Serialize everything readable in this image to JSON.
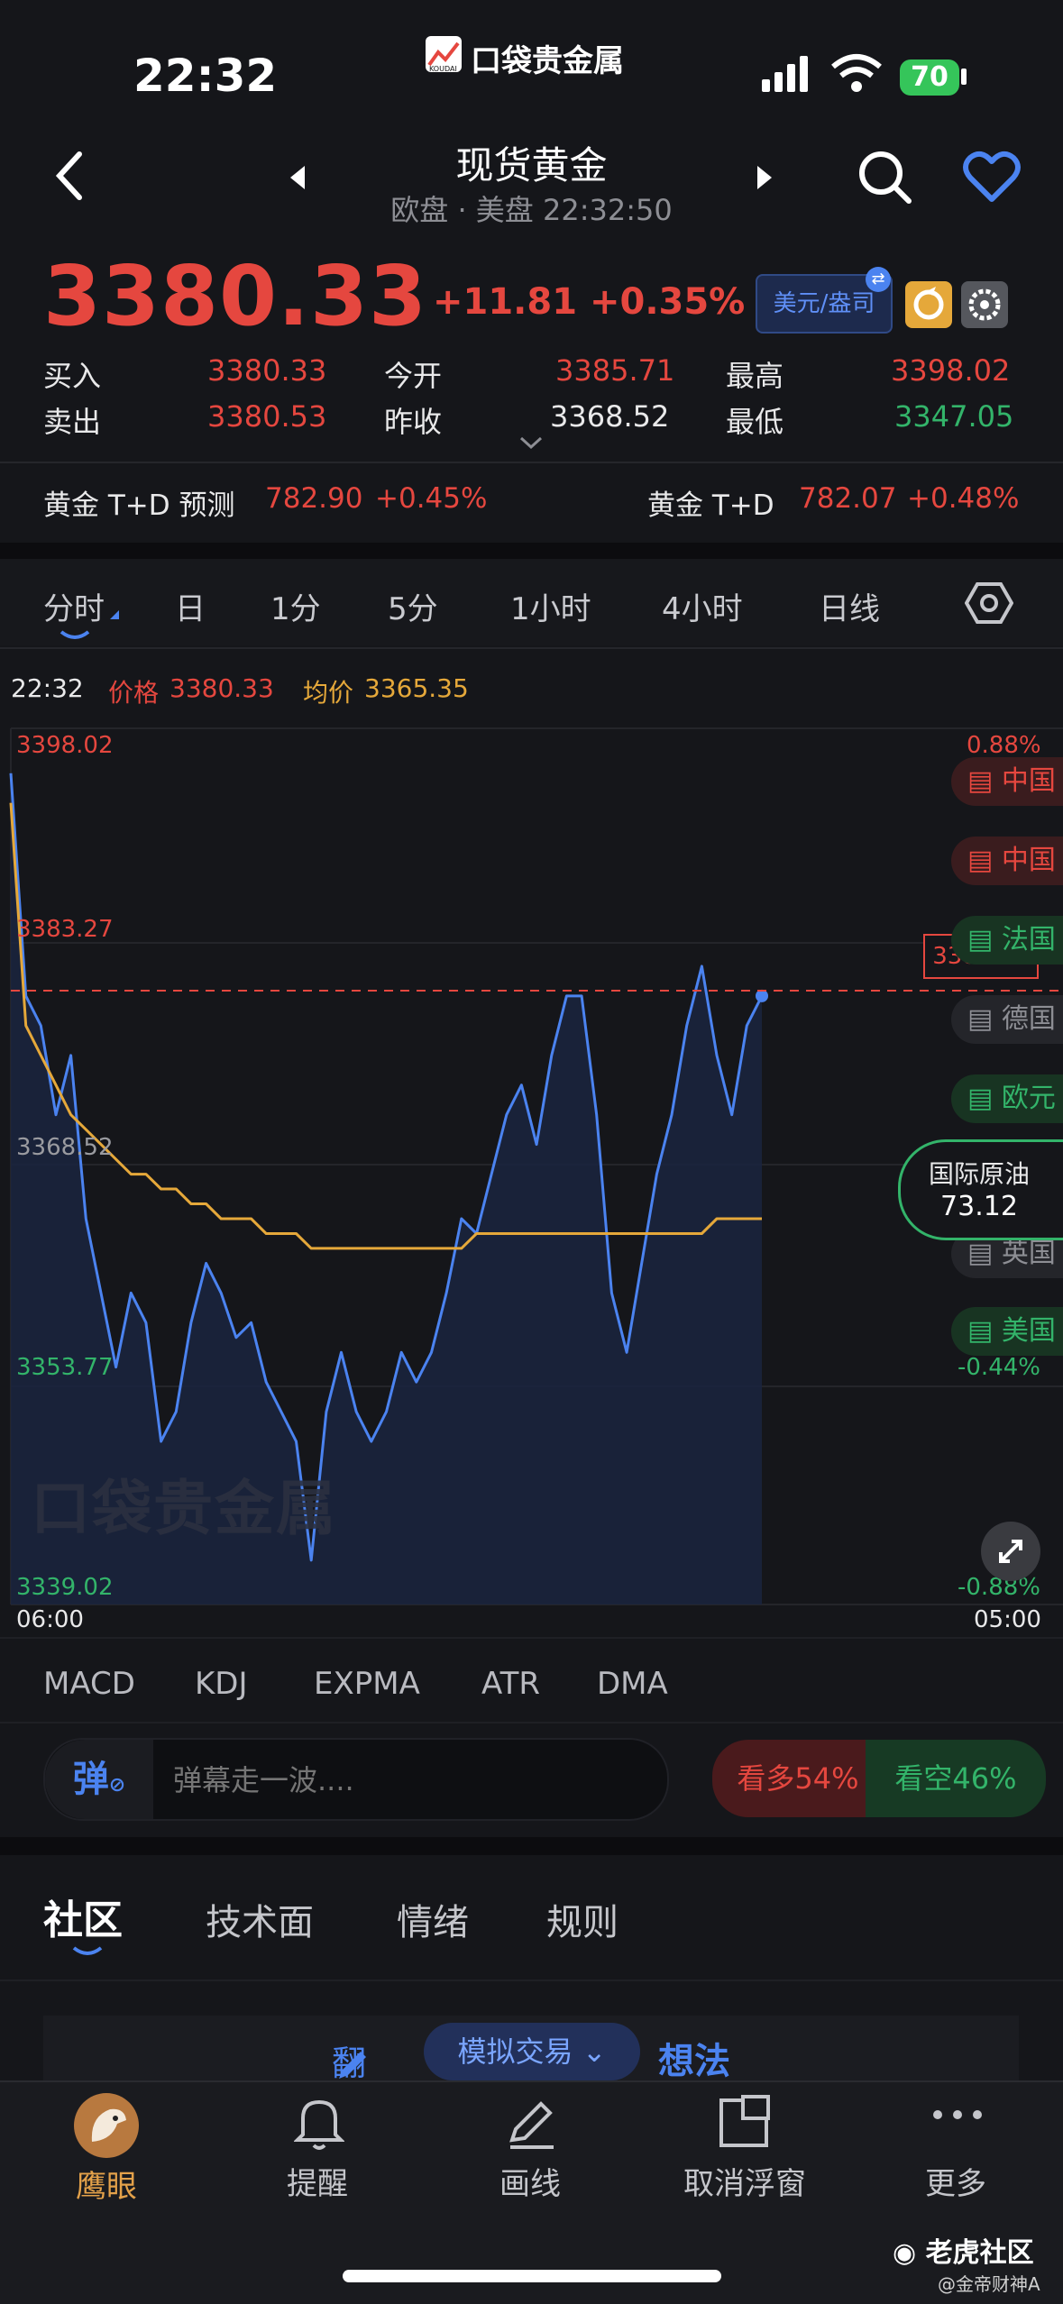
{
  "status_bar": {
    "time": "22:32",
    "app_logo": "口袋贵金属",
    "app_logo_sub": "KOUDAI",
    "battery": "70"
  },
  "header": {
    "title": "现货黄金",
    "subtitle": "欧盘 · 美盘 22:32:50"
  },
  "quote": {
    "price": "3380.33",
    "change": "+11.81 +0.35%",
    "currency_btn": "美元/盎司",
    "bid_label": "买入",
    "bid": "3380.33",
    "ask_label": "卖出",
    "ask": "3380.53",
    "open_label": "今开",
    "open": "3385.71",
    "prev_label": "昨收",
    "prev": "3368.52",
    "high_label": "最高",
    "high": "3398.02",
    "low_label": "最低",
    "low": "3347.05"
  },
  "td": {
    "forecast_label": "黄金 T+D 预测",
    "forecast_value": "782.90",
    "forecast_pct": "+0.45%",
    "td_label": "黄金 T+D",
    "td_value": "782.07",
    "td_pct": "+0.48%"
  },
  "period_tabs": [
    "分时",
    "日",
    "1分",
    "5分",
    "1小时",
    "4小时",
    "日线"
  ],
  "chart_head": {
    "time": "22:32",
    "price_label": "价格",
    "price": "3380.33",
    "avg_label": "均价",
    "avg": "3365.35"
  },
  "chart_data": {
    "type": "line",
    "series": [
      {
        "name": "价格",
        "values": [
          3395,
          3380,
          3378,
          3372,
          3376,
          3365,
          3360,
          3355,
          3360,
          3358,
          3350,
          3352,
          3358,
          3362,
          3360,
          3357,
          3358,
          3354,
          3352,
          3350,
          3342,
          3352,
          3356,
          3352,
          3350,
          3352,
          3356,
          3354,
          3356,
          3360,
          3365,
          3364,
          3368,
          3372,
          3374,
          3370,
          3376,
          3380,
          3380,
          3372,
          3360,
          3356,
          3362,
          3368,
          3372,
          3378,
          3382,
          3376,
          3372,
          3378,
          3380
        ]
      },
      {
        "name": "均价",
        "values": [
          3393,
          3378,
          3376,
          3374,
          3372,
          3371,
          3370,
          3369,
          3368,
          3368,
          3367,
          3367,
          3366,
          3366,
          3365,
          3365,
          3365,
          3364,
          3364,
          3364,
          3363,
          3363,
          3363,
          3363,
          3363,
          3363,
          3363,
          3363,
          3363,
          3363,
          3363,
          3364,
          3364,
          3364,
          3364,
          3364,
          3364,
          3364,
          3364,
          3364,
          3364,
          3364,
          3364,
          3364,
          3364,
          3364,
          3364,
          3365,
          3365,
          3365,
          3365
        ]
      }
    ],
    "y_ticks": [
      "3398.02",
      "3383.27",
      "3368.52",
      "3353.77",
      "3339.02"
    ],
    "pct_ticks": [
      "0.88%",
      "-0.44%",
      "-0.88%"
    ],
    "x_ticks": [
      "06:00",
      "05:00"
    ],
    "ylim": [
      3339.02,
      3398.02
    ],
    "current_price_label": "3380.33",
    "watermark": "口袋贵金属"
  },
  "event_tags": {
    "labels": [
      "中国",
      "中国",
      "法国",
      "德国",
      "欧元",
      "英国",
      "美国"
    ],
    "colors": [
      "#e5473f",
      "#e5473f",
      "#33b46a",
      "#8d8e94",
      "#33b46a",
      "#8d8e94",
      "#33b46a"
    ]
  },
  "oil_bubble": {
    "name": "国际原油",
    "value": "73.12"
  },
  "indicator_tabs": [
    "MACD",
    "KDJ",
    "EXPMA",
    "ATR",
    "DMA"
  ],
  "danmu": {
    "icon_text": "弹",
    "placeholder": "弹幕走一波...."
  },
  "sentiment": {
    "bull": "看多54%",
    "bear": "看空46%"
  },
  "content_tabs": [
    "社区",
    "技术面",
    "情绪",
    "规则"
  ],
  "partial_banner": {
    "left": "翻",
    "right": "想法"
  },
  "sim_trade": "模拟交易",
  "bottom_nav": [
    "鹰眼",
    "提醒",
    "画线",
    "取消浮窗",
    "更多"
  ],
  "watermark_footer": {
    "brand": "老虎社区",
    "user": "@金帝财神A"
  },
  "colors": {
    "up": "#e5473f",
    "down": "#33b46a",
    "accent": "#4b83f0",
    "avg_line": "#e5a83a",
    "background": "#15161a"
  }
}
